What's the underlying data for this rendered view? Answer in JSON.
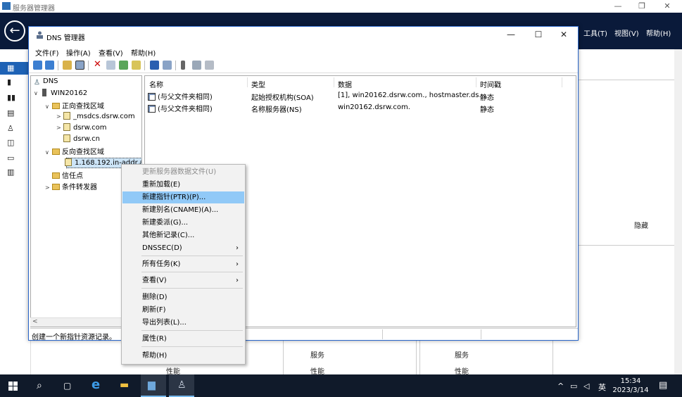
{
  "outer": {
    "title": "服务器管理器",
    "menus": [
      "工具(T)",
      "视图(V)",
      "帮助(H)"
    ],
    "hide_label": "隐藏",
    "tiles": [
      {
        "services": "服务",
        "performance": "性能"
      },
      {
        "services": "服务",
        "performance": "性能"
      },
      {
        "performance": "性能"
      }
    ]
  },
  "dns_window": {
    "title": "DNS 管理器",
    "menu": [
      "文件(F)",
      "操作(A)",
      "查看(V)",
      "帮助(H)"
    ],
    "tree": {
      "root": "DNS",
      "server": "WIN20162",
      "forward": "正向查找区域",
      "forward_children": [
        "_msdcs.dsrw.com",
        "dsrw.com",
        "dsrw.cn"
      ],
      "reverse": "反向查找区域",
      "reverse_selected": "1.168.192.in-addr.a",
      "trust": "信任点",
      "forwarders": "条件转发器"
    },
    "list": {
      "columns": [
        "名称",
        "类型",
        "数据",
        "时间戳"
      ],
      "rows": [
        {
          "name": "(与父文件夹相同)",
          "type": "起始授权机构(SOA)",
          "data": "[1], win20162.dsrw.com., hostmaster.ds...",
          "time": "静态"
        },
        {
          "name": "(与父文件夹相同)",
          "type": "名称服务器(NS)",
          "data": "win20162.dsrw.com.",
          "time": "静态"
        }
      ]
    },
    "status": "创建一个新指针资源记录。"
  },
  "context_menu": {
    "items": [
      {
        "label": "更新服务器数据文件(U)",
        "disabled": true
      },
      {
        "label": "重新加载(E)"
      },
      {
        "label": "新建指针(PTR)(P)...",
        "highlighted": true
      },
      {
        "label": "新建别名(CNAME)(A)..."
      },
      {
        "label": "新建委派(G)..."
      },
      {
        "label": "其他新记录(C)..."
      },
      {
        "label": "DNSSEC(D)",
        "submenu": true
      },
      {
        "label": "所有任务(K)",
        "submenu": true
      },
      {
        "label": "查看(V)",
        "submenu": true
      },
      {
        "label": "删除(D)"
      },
      {
        "label": "刷新(F)"
      },
      {
        "label": "导出列表(L)..."
      },
      {
        "label": "属性(R)"
      },
      {
        "label": "帮助(H)"
      }
    ]
  },
  "taskbar": {
    "time": "15:34",
    "date": "2023/3/14",
    "ime": "英",
    "chevron": "^"
  },
  "colors": {
    "header_bg": "#0a1a3a",
    "menu_highlight": "#91c9f7",
    "taskbar_bg": "#101a2a",
    "accent": "#1e62b5"
  }
}
